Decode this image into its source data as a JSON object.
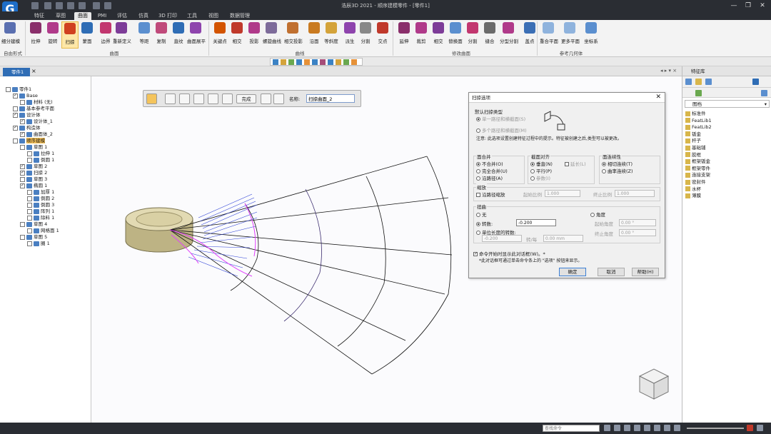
{
  "window": {
    "title": "浩辰3D 2021 - 顺序建模零件 - [零件1]"
  },
  "menu": [
    "特征",
    "草图",
    "曲面",
    "PMI",
    "评估",
    "仿真",
    "3D 打印",
    "工具",
    "视图",
    "数据管理"
  ],
  "menu_active": "曲面",
  "ribbon": {
    "buttons": [
      "细分建模",
      "拉伸",
      "旋转",
      "扫掠",
      "蒙面",
      "边界",
      "重新定义",
      "等距",
      "复制",
      "直纹",
      "曲面展平",
      "关键点",
      "相交",
      "投影",
      "螺旋曲线",
      "相交投影",
      "沿面",
      "等斜度",
      "派生",
      "分割",
      "交点",
      "延伸",
      "裁剪",
      "相交",
      "替换面",
      "分割",
      "缝合",
      "分型分割",
      "盖点",
      "重合平面",
      "更多平面",
      "坐标系"
    ],
    "selected": "扫掠",
    "groups": [
      "自由形式",
      "曲面",
      "曲线",
      "修改曲面",
      "参考几何体"
    ]
  },
  "doc_tab": "零件1",
  "tree": [
    {
      "label": "零件1",
      "level": 0,
      "check": false
    },
    {
      "label": "Base",
      "level": 1,
      "check": true
    },
    {
      "label": "材料 (无)",
      "level": 2,
      "check": false
    },
    {
      "label": "基本参考平面",
      "level": 1,
      "check": false
    },
    {
      "label": "设计体",
      "level": 1,
      "check": true
    },
    {
      "label": "设计体_1",
      "level": 2,
      "check": true
    },
    {
      "label": "构造体",
      "level": 1,
      "check": true
    },
    {
      "label": "曲面体_2",
      "level": 2,
      "check": true
    },
    {
      "label": "顺序建模",
      "level": 1,
      "check": false,
      "highlight": true
    },
    {
      "label": "草图 1",
      "level": 2,
      "check": false
    },
    {
      "label": "拉伸 1",
      "level": 3,
      "check": false
    },
    {
      "label": "倒圆 1",
      "level": 3,
      "check": false
    },
    {
      "label": "草图 2",
      "level": 2,
      "check": true
    },
    {
      "label": "扫掠 2",
      "level": 2,
      "check": true
    },
    {
      "label": "草图 3",
      "level": 2,
      "check": false
    },
    {
      "label": "椭圆 1",
      "level": 2,
      "check": true
    },
    {
      "label": "加厚 1",
      "level": 3,
      "check": false
    },
    {
      "label": "倒圆 2",
      "level": 3,
      "check": false
    },
    {
      "label": "倒圆 3",
      "level": 3,
      "check": false
    },
    {
      "label": "阵列 1",
      "level": 3,
      "check": false
    },
    {
      "label": "除料 1",
      "level": 3,
      "check": false
    },
    {
      "label": "草图 4",
      "level": 2,
      "check": false
    },
    {
      "label": "网格面 1",
      "level": 3,
      "check": false
    },
    {
      "label": "草图 5",
      "level": 2,
      "check": false
    },
    {
      "label": "圈 1",
      "level": 3,
      "check": false
    }
  ],
  "floatbar": {
    "finish": "完成",
    "name_label": "名称:",
    "name_value": "扫掠曲面_2"
  },
  "dialog": {
    "title": "扫掠选项",
    "type_group": "默认扫掠类型",
    "type_single": "单一路径和横截面(S)",
    "type_multi": "多个路径和横截面(M)",
    "note": "注意:  此选项设置创建特征过程中的提示。特征被创建之后,类型可以被更改。",
    "merge_group": "面合并",
    "merge_options": [
      "不合并(O)",
      "完全合并(U)",
      "沿路径(A)"
    ],
    "align_group": "截面对齐",
    "align_options": [
      "垂直(N)",
      "平行(P)",
      "参数(I)"
    ],
    "align_extend": "延长(L)",
    "continuity_group": "面连续性",
    "continuity_options": [
      "相切连续(T)",
      "曲率连续(Z)"
    ],
    "scale_group": "缩放",
    "scale_check": "沿路径缩放",
    "start_ratio_label": "起始比例",
    "start_ratio": "1.000",
    "end_ratio_label": "终止比例",
    "end_ratio": "1.000",
    "twist_group": "扭曲",
    "twist_none": "无",
    "twist_turns": "转数:",
    "twist_turns_value": "-0.200",
    "twist_per_length": "单位长度的转数:",
    "twist_per_value": "-0.200",
    "twist_per_unit": "转/每",
    "twist_per_len": "0.00 mm",
    "twist_angle": "角度",
    "start_angle_label": "起始角度",
    "start_angle": "0.00 °",
    "end_angle_label": "终止角度",
    "end_angle": "0.00 °",
    "show_check": "命令开始时显示此对话框(W)。*",
    "show_note": "*此对话框可通过单击命令条上的 \"选项\" 按钮来显示。",
    "ok": "确定",
    "cancel": "取消",
    "help": "帮助(H)"
  },
  "right_panel": {
    "title": "特征库",
    "folder": "图档",
    "items": [
      "标准件",
      "FeatLib1",
      "FeatLib2",
      "钣金",
      "杆子",
      "基础铺",
      "胶框",
      "框架钣金",
      "框架零件",
      "连接支架",
      "密封件",
      "水杯",
      "薄膜"
    ]
  },
  "status": {
    "cmd_placeholder": "查找命令"
  },
  "colors": {
    "accent": "#2f6db5",
    "sweep_lines": "#2b3fd6",
    "highlight": "#e040fb",
    "selected_tab": "#f7c35a"
  }
}
